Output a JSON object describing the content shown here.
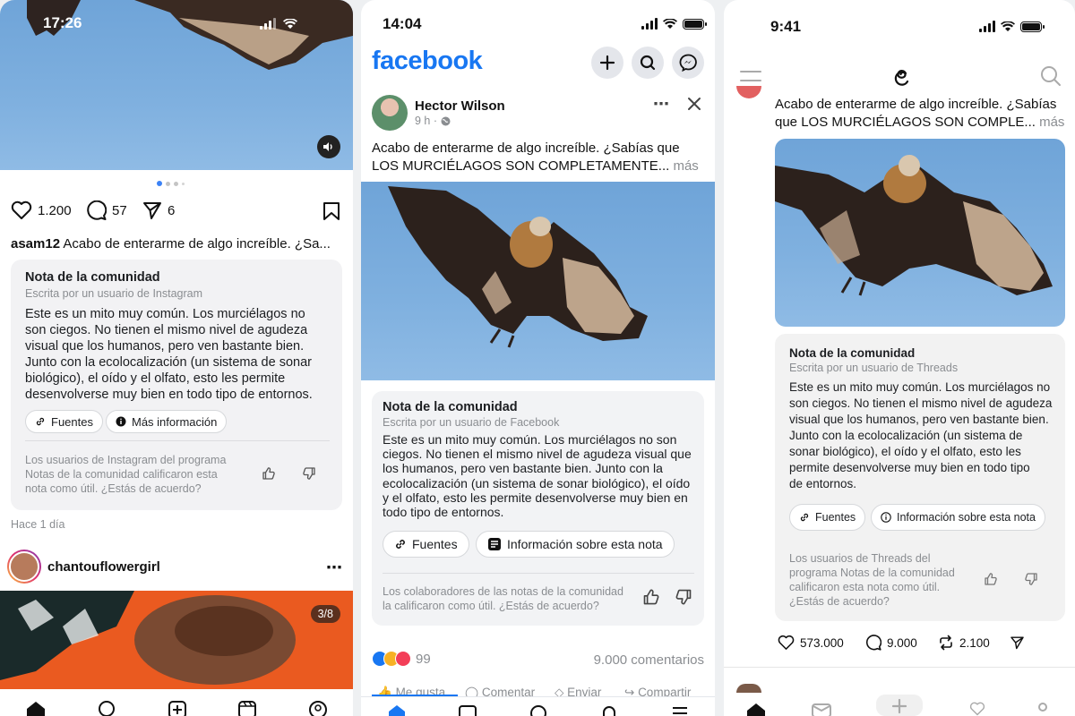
{
  "instagram": {
    "status": {
      "time": "17:26"
    },
    "media": {
      "dots": 4
    },
    "actions": {
      "likes": "1.200",
      "comments": "57",
      "shares": "6"
    },
    "caption": {
      "user": "asam12",
      "text": "Acabo de enterarme de algo increíble. ¿Sa..."
    },
    "note": {
      "title": "Nota de la comunidad",
      "subtitle": "Escrita por un usuario de Instagram",
      "body": [
        "Este es un mito muy común. Los murciélagos no",
        "son ciegos. No tienen el mismo nivel de agudeza",
        "visual que los humanos, pero ven bastante bien.",
        "Junto con la ecolocalización (un sistema de sonar",
        "biológico), el oído y el olfato, esto les permite",
        "desenvolverse muy bien en todo tipo de entornos."
      ],
      "sources": "Fuentes",
      "more_info": "Más información",
      "footer": [
        "Los usuarios de Instagram del programa",
        "Notas de la comunidad calificaron esta",
        "nota como útil. ¿Estás de acuerdo?"
      ]
    },
    "time_ago": "Hace 1 día",
    "next_post": {
      "user": "chantouflowergirl",
      "counter": "3/8"
    }
  },
  "facebook": {
    "status": {
      "time": "14:04"
    },
    "logo": "facebook",
    "accent": "#1877f2",
    "post": {
      "author": "Hector Wilson",
      "time": "9 h ·"
    },
    "text": {
      "line1": "Acabo de enterarme de algo increíble. ¿Sabías que",
      "line2": "LOS MURCIÉLAGOS SON COMPLETAMENTE...",
      "more": "más"
    },
    "note": {
      "title": "Nota de la comunidad",
      "subtitle": "Escrita por un usuario de Facebook",
      "body": [
        "Este es un mito muy común. Los murciélagos no son",
        "ciegos. No tienen el mismo nivel de agudeza visual que",
        "los humanos, pero ven bastante bien. Junto con la",
        "ecolocalización (un sistema de sonar biológico), el oído",
        "y el olfato, esto les permite desenvolverse muy bien en",
        "todo tipo de entornos."
      ],
      "sources": "Fuentes",
      "info": "Información sobre esta nota",
      "footer": [
        "Los colaboradores de las notas de la comunidad",
        "la calificaron como útil. ¿Estás de acuerdo?"
      ]
    },
    "reactions": {
      "count": "99",
      "comments": "9.000 comentarios"
    },
    "actions": {
      "like": "Me gusta",
      "comment": "Comentar",
      "send": "Enviar",
      "share": "Compartir"
    }
  },
  "threads": {
    "status": {
      "time": "9:41"
    },
    "text": {
      "line1": "Acabo de enterarme de algo increíble. ¿Sabías",
      "line2": "que LOS MURCIÉLAGOS SON COMPLE...",
      "more": "más"
    },
    "note": {
      "title": "Nota de la comunidad",
      "subtitle": "Escrita por un usuario de Threads",
      "body": [
        "Este es un mito muy común. Los murciélagos no",
        "son ciegos. No tienen el mismo nivel de agudeza",
        "visual que los humanos, pero ven bastante bien.",
        "Junto con la ecolocalización (un sistema de",
        "sonar biológico), el oído y el olfato, esto les",
        "permite desenvolverse muy bien en todo tipo",
        "de entornos."
      ],
      "sources": "Fuentes",
      "info": "Información sobre esta nota",
      "footer": [
        "Los usuarios de Threads del",
        "programa Notas de la comunidad",
        "calificaron esta nota como útil.",
        "¿Estás de acuerdo?"
      ]
    },
    "actions": {
      "likes": "573.000",
      "comments": "9.000",
      "reposts": "2.100"
    }
  }
}
